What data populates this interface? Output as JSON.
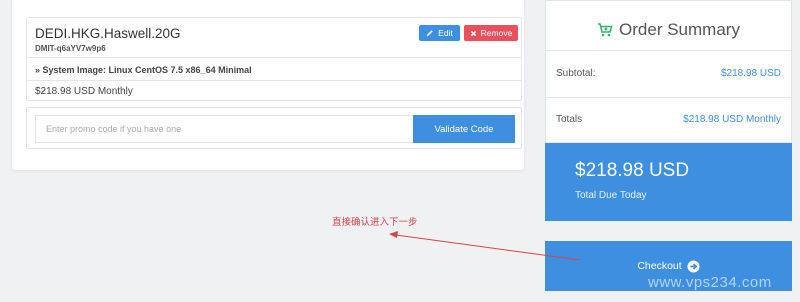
{
  "cart": {
    "product_name": "DEDI.HKG.Haswell.20G",
    "hostname": "DMIT-q6aYV7w9p6",
    "edit_label": "Edit",
    "remove_label": "Remove",
    "config_line": "» System Image: Linux CentOS 7.5 x86_64 Minimal",
    "price_line": "$218.98 USD Monthly",
    "promo_placeholder": "Enter promo code if you have one",
    "promo_button": "Validate Code"
  },
  "summary": {
    "title": "Order Summary",
    "subtotal_label": "Subtotal:",
    "subtotal_value": "$218.98 USD",
    "totals_label": "Totals",
    "totals_value": "$218.98 USD Monthly",
    "total_due_amount": "$218.98 USD",
    "total_due_label": "Total Due Today",
    "checkout_label": "Checkout"
  },
  "annotation": {
    "text": "直接确认进入下一步"
  },
  "watermark": "www.vps234.com",
  "colors": {
    "accent": "#3f8fe0",
    "danger": "#e8505b",
    "cart_icon": "#2fb36a",
    "annotation": "#d64545"
  },
  "icons": {
    "edit": "pencil-icon",
    "remove": "close-icon",
    "summary": "cart-plus-icon",
    "checkout": "arrow-circle-right-icon"
  }
}
